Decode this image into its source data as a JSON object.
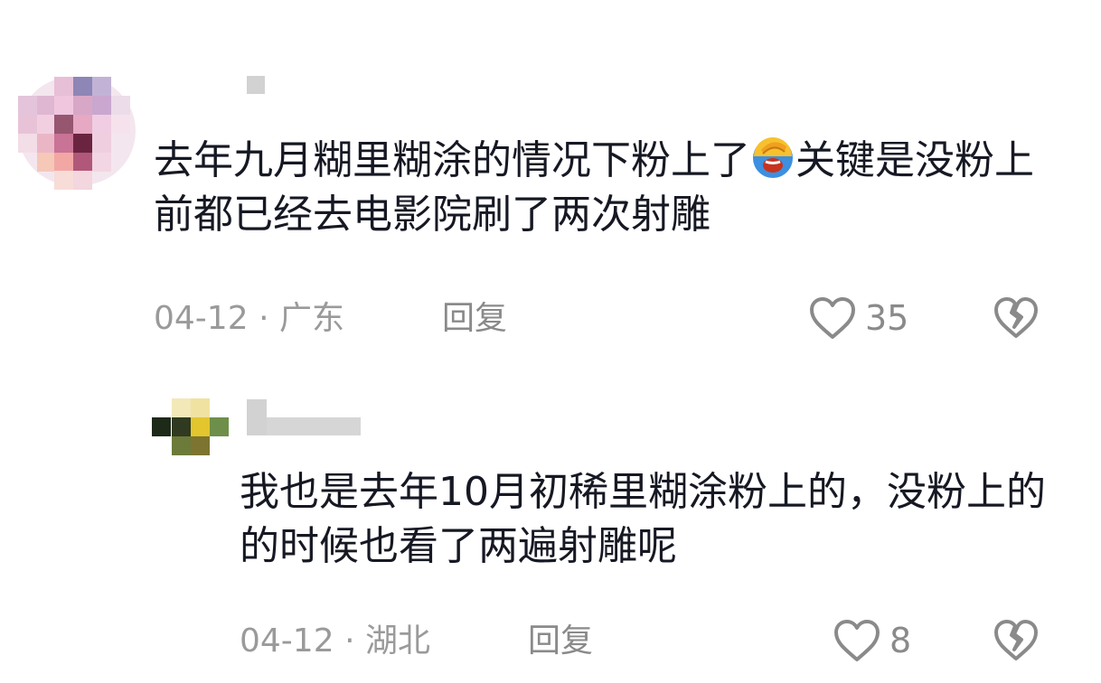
{
  "comments": [
    {
      "text_part1": "去年九月糊里糊涂的情况下粉上了",
      "emoji": "face-palm-laughing-emoji",
      "text_part2": "关键是没粉上前都已经去电影院刷了两次射雕",
      "date": "04-12",
      "separator": "·",
      "location": "广东",
      "reply_label": "回复",
      "like_count": "35"
    },
    {
      "text": "我也是去年10月初稀里糊涂粉上的，没粉上的的时候也看了两遍射雕呢",
      "date": "04-12",
      "separator": "·",
      "location": "湖北",
      "reply_label": "回复",
      "like_count": "8"
    }
  ],
  "colors": {
    "text": "#161823",
    "meta": "#9a9a9a",
    "icon": "#8a8a8a"
  }
}
